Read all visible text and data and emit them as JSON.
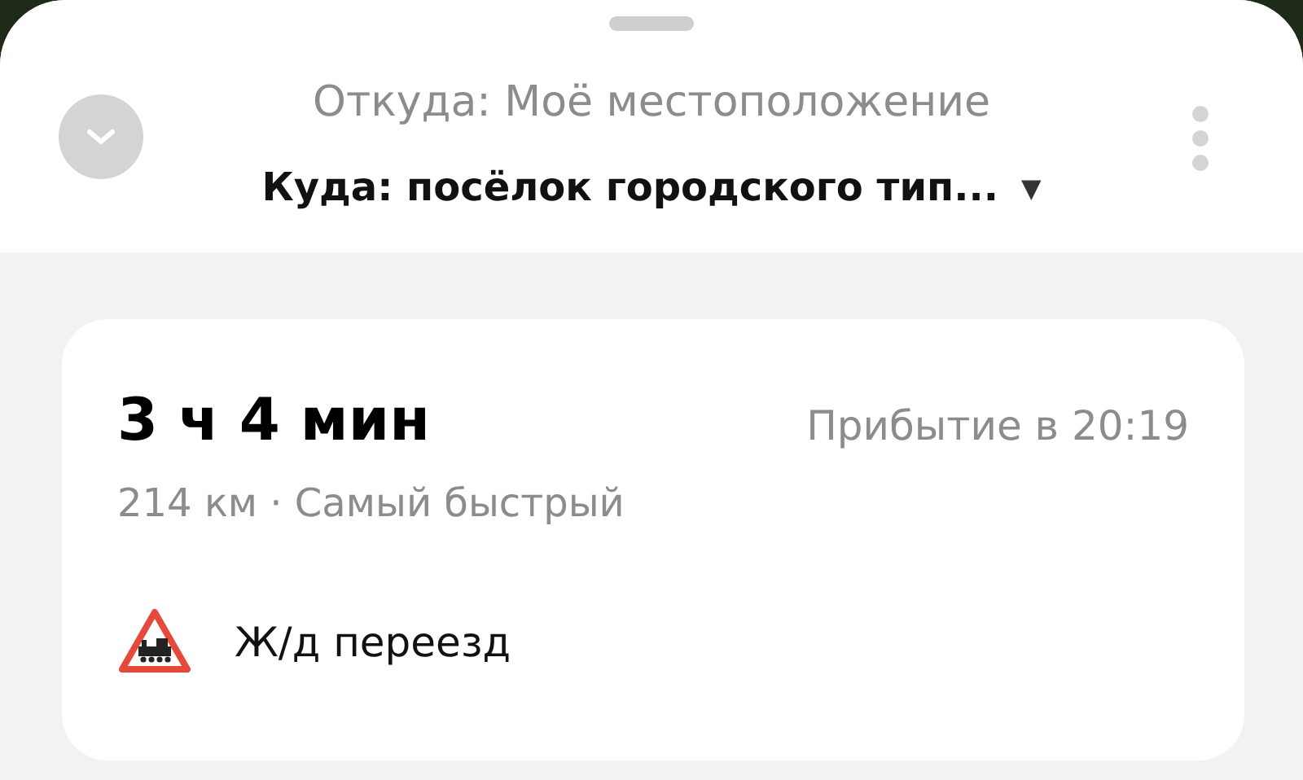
{
  "route_header": {
    "from": "Откуда: Моё местоположение",
    "to": "Куда: посёлок городского тип...",
    "to_dropdown": "▼"
  },
  "route_card": {
    "duration": "3 ч 4 мин",
    "arrival": "Прибытие в 20:19",
    "details": "214 км · Самый быстрый",
    "warnings": [
      {
        "kind": "railway_crossing",
        "label": "Ж/д переезд"
      }
    ]
  }
}
